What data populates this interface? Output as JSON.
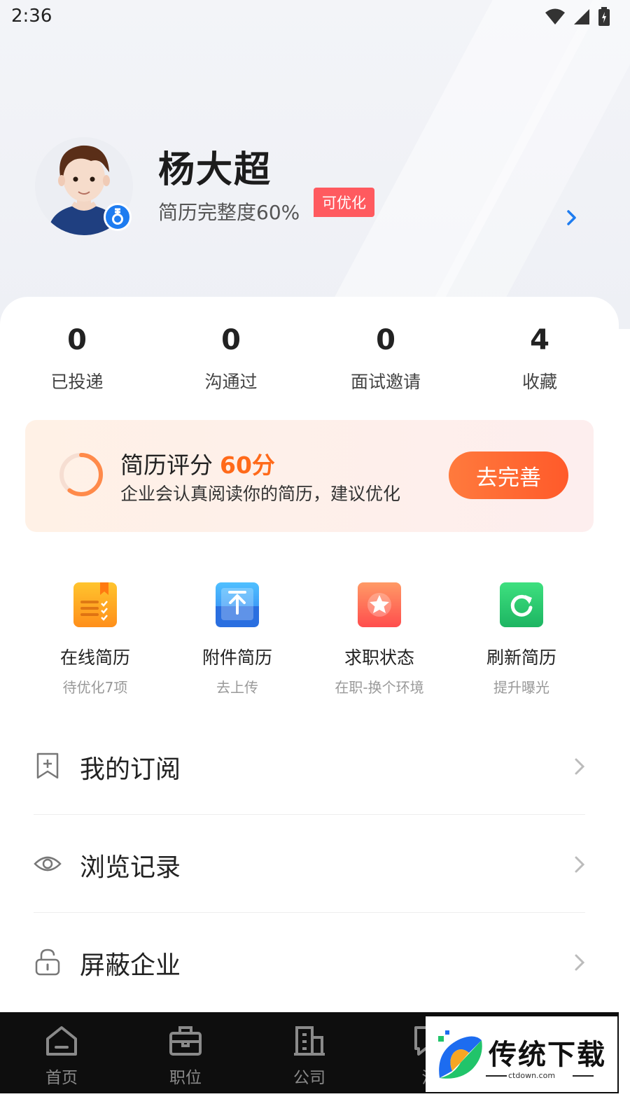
{
  "status_bar": {
    "time": "2:36"
  },
  "profile": {
    "name": "杨大超",
    "resume_completeness": "简历完整度60%",
    "optimize_tag": "可优化"
  },
  "stats": [
    {
      "value": "0",
      "label": "已投递"
    },
    {
      "value": "0",
      "label": "沟通过"
    },
    {
      "value": "0",
      "label": "面试邀请"
    },
    {
      "value": "4",
      "label": "收藏"
    }
  ],
  "score_card": {
    "title": "简历评分",
    "score": "60分",
    "score_fraction": 0.6,
    "description": "企业会认真阅读你的简历，建议优化",
    "button": "去完善"
  },
  "tools": [
    {
      "title": "在线简历",
      "subtitle": "待优化7项",
      "icon": "resume-doc-icon",
      "color": "#ff9f1a"
    },
    {
      "title": "附件简历",
      "subtitle": "去上传",
      "icon": "upload-icon",
      "color": "#2f8cf0"
    },
    {
      "title": "求职状态",
      "subtitle": "在职-换个环境",
      "icon": "star-icon",
      "color": "#ff6b4a"
    },
    {
      "title": "刷新简历",
      "subtitle": "提升曝光",
      "icon": "refresh-icon",
      "color": "#2ec66e"
    }
  ],
  "menu": [
    {
      "label": "我的订阅",
      "icon": "bookmark-plus-icon"
    },
    {
      "label": "浏览记录",
      "icon": "eye-icon"
    },
    {
      "label": "屏蔽企业",
      "icon": "lock-icon"
    }
  ],
  "bottom_nav": [
    {
      "label": "首页",
      "icon": "home-icon"
    },
    {
      "label": "职位",
      "icon": "briefcase-icon"
    },
    {
      "label": "公司",
      "icon": "building-icon"
    },
    {
      "label": "消",
      "icon": "message-icon"
    }
  ],
  "watermark": {
    "text": "传统下载",
    "sub": "ctdown.com"
  },
  "colors": {
    "accent_orange": "#ff6a1a",
    "tag_red": "#ff5a5f",
    "link_blue": "#1e7cf0"
  }
}
